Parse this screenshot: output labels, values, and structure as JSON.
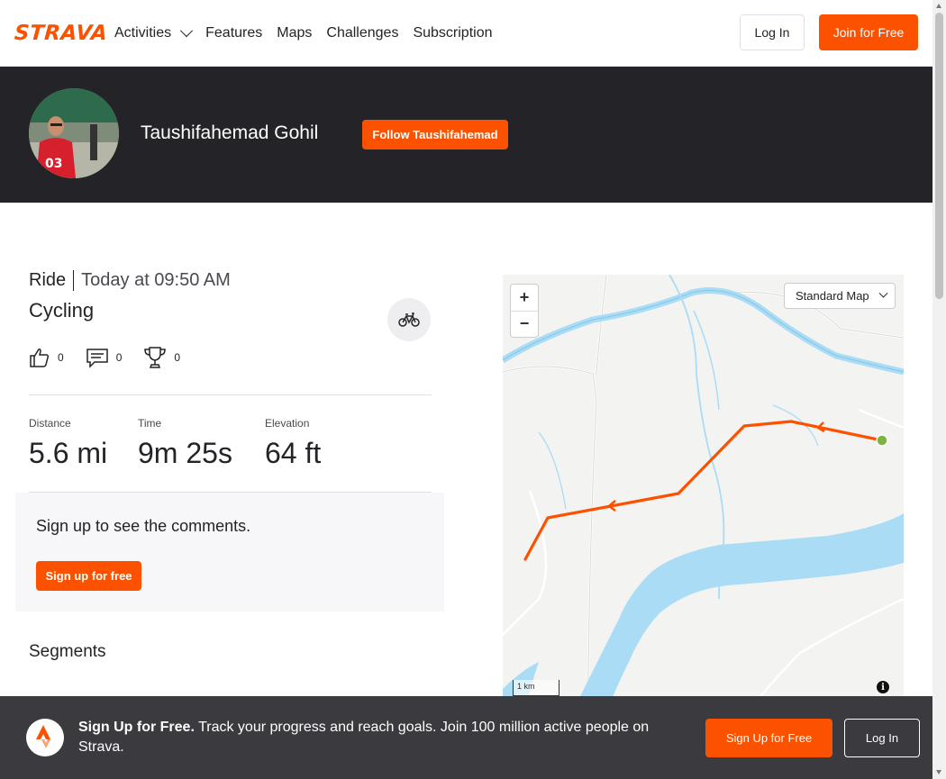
{
  "nav": {
    "logo": "STRAVA",
    "links": [
      "Activities",
      "Features",
      "Maps",
      "Challenges",
      "Subscription"
    ],
    "login_label": "Log In",
    "join_label": "Join for Free"
  },
  "athlete": {
    "name": "Taushifahemad Gohil",
    "follow_label": "Follow Taushifahemad"
  },
  "activity": {
    "type": "Ride",
    "time": "Today at 09:50 AM",
    "title": "Cycling",
    "kudos_count": "0",
    "comment_count": "0",
    "achievement_count": "0",
    "stats": [
      {
        "label": "Distance",
        "value": "5.6 mi"
      },
      {
        "label": "Time",
        "value": "9m 25s"
      },
      {
        "label": "Elevation",
        "value": "64 ft"
      }
    ]
  },
  "comments": {
    "title": "Sign up to see the comments.",
    "signup_label": "Sign up for free"
  },
  "segments": {
    "title": "Segments"
  },
  "map": {
    "style_label": "Standard Map",
    "zoom_in": "+",
    "zoom_out": "−",
    "scale_label": "1 km",
    "info": "i",
    "route_color": "#fc5200",
    "start_color": "#7cb342",
    "water_color": "#aadcf5"
  },
  "banner": {
    "headline": "Sign Up for Free.",
    "text": " Track your progress and reach goals. Join 100 million active people on Strava.",
    "signup_label": "Sign Up for Free",
    "login_label": "Log In"
  },
  "colors": {
    "brand": "#fc5200",
    "dark_band": "#242428",
    "banner_bg": "#3a3a3f"
  }
}
